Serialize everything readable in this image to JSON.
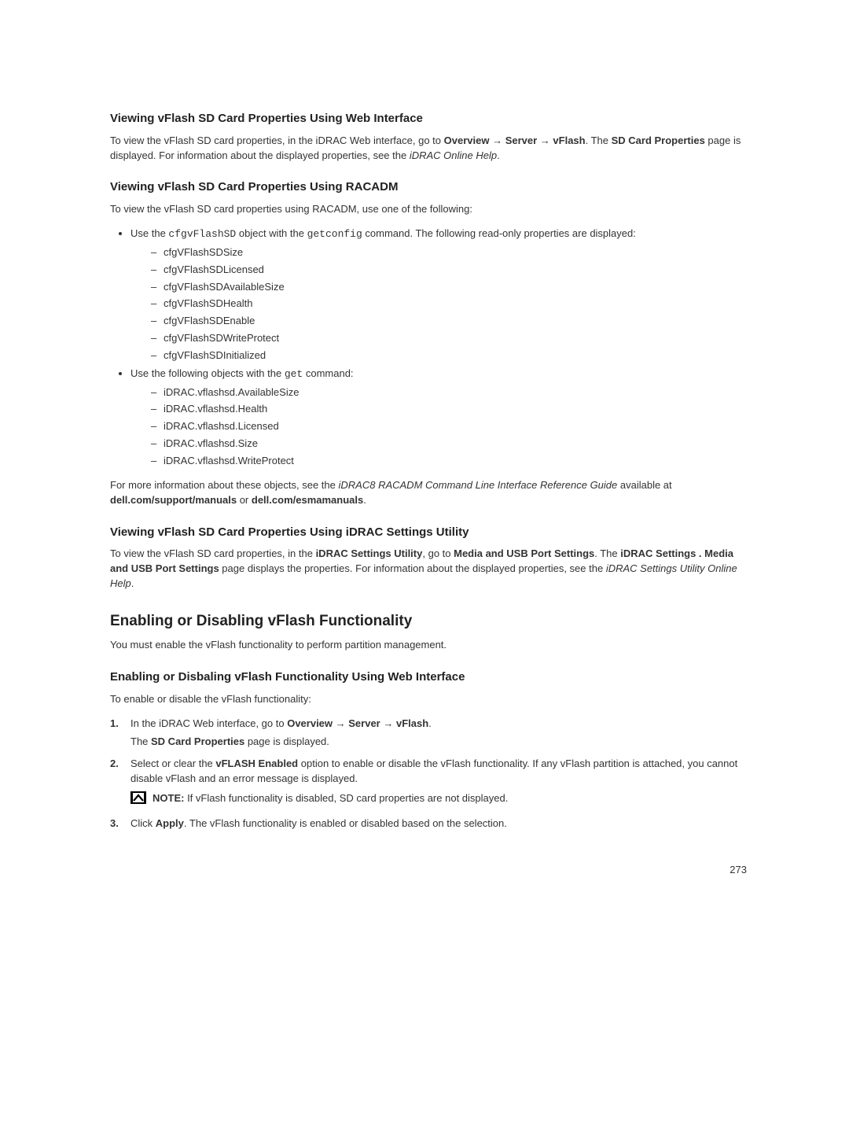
{
  "s1": {
    "heading": "Viewing vFlash SD Card Properties Using Web Interface",
    "p1_a": "To view the vFlash SD card properties, in the iDRAC Web interface, go to ",
    "p1_overview": "Overview",
    "p1_arrow1": " → ",
    "p1_server": "Server",
    "p1_arrow2": " → ",
    "p1_vflash": "vFlash",
    "p1_b": ". The ",
    "p1_sdcard": "SD Card Properties",
    "p1_c": " page is displayed. For information about the displayed properties, see the ",
    "p1_italic": "iDRAC Online Help",
    "p1_d": "."
  },
  "s2": {
    "heading": "Viewing vFlash SD Card Properties Using RACADM",
    "intro": "To view the vFlash SD card properties using RACADM, use one of the following:",
    "b1_a": "Use the ",
    "b1_code1": "cfgvFlashSD",
    "b1_b": " object with the ",
    "b1_code2": "getconfig",
    "b1_c": " command. The following read-only properties are displayed:",
    "list1": [
      "cfgVFlashSDSize",
      "cfgVFlashSDLicensed",
      "cfgVFlashSDAvailableSize",
      "cfgVFlashSDHealth",
      "cfgVFlashSDEnable",
      "cfgVFlashSDWriteProtect",
      "cfgVFlashSDInitialized"
    ],
    "b2_a": "Use the following objects with the ",
    "b2_code": "get",
    "b2_b": " command:",
    "list2": [
      "iDRAC.vflashsd.AvailableSize",
      "iDRAC.vflashsd.Health",
      "iDRAC.vflashsd.Licensed",
      "iDRAC.vflashsd.Size",
      "iDRAC.vflashsd.WriteProtect"
    ],
    "p2_a": "For more information about these objects, see the ",
    "p2_italic": "iDRAC8 RACADM Command Line Interface Reference Guide",
    "p2_b": " available at ",
    "p2_bold1": "dell.com/support/manuals",
    "p2_c": " or ",
    "p2_bold2": "dell.com/esmamanuals",
    "p2_d": "."
  },
  "s3": {
    "heading": "Viewing vFlash SD Card Properties Using iDRAC Settings Utility",
    "p_a": "To view the vFlash SD card properties, in the ",
    "p_b1": "iDRAC Settings Utility",
    "p_b": ", go to ",
    "p_b2": "Media and USB Port Settings",
    "p_c": ". The ",
    "p_b3": "iDRAC Settings . Media and USB Port Settings",
    "p_d": " page displays the properties. For information about the displayed properties, see the ",
    "p_italic": "iDRAC Settings Utility Online Help",
    "p_e": "."
  },
  "s4": {
    "heading": "Enabling or Disabling vFlash Functionality",
    "intro": "You must enable the vFlash functionality to perform partition management."
  },
  "s5": {
    "heading": "Enabling or Disbaling vFlash Functionality Using Web Interface",
    "intro": "To enable or disable the vFlash functionality:",
    "step1_num": "1.",
    "step1_a": "In the iDRAC Web interface, go to ",
    "step1_overview": "Overview",
    "step1_arrow1": " → ",
    "step1_server": "Server",
    "step1_arrow2": " → ",
    "step1_vflash": "vFlash",
    "step1_b": ".",
    "step1_line2a": "The ",
    "step1_line2b": "SD Card Properties",
    "step1_line2c": " page is displayed.",
    "step2_num": "2.",
    "step2_a": "Select or clear the ",
    "step2_bold": "vFLASH Enabled",
    "step2_b": " option to enable or disable the vFlash functionality. If any vFlash partition is attached, you cannot disable vFlash and an error message is displayed.",
    "note_label": "NOTE:",
    "note_text": " If vFlash functionality is disabled, SD card properties are not displayed.",
    "step3_num": "3.",
    "step3_a": "Click ",
    "step3_bold": "Apply",
    "step3_b": ". The vFlash functionality is enabled or disabled based on the selection."
  },
  "page_number": "273"
}
